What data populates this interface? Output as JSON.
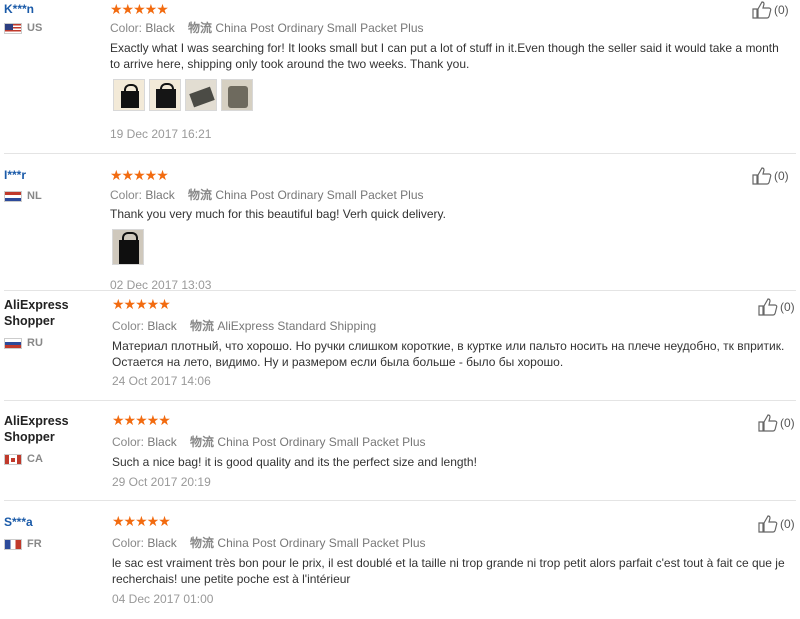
{
  "reviews": [
    {
      "user": "K***n",
      "country": "US",
      "color_label": "Color:",
      "color": "Black",
      "shipping_label": "物流",
      "shipping": "China Post Ordinary Small Packet Plus",
      "text": "Exactly what I was searching for! It looks small but I can put a lot of stuff in it.Even though the seller said it would take a month to arrive here, shipping only took around the two weeks. Thank you.",
      "date": "19 Dec 2017 16:21",
      "likes": "(0)"
    },
    {
      "user": "I***r",
      "country": "NL",
      "color_label": "Color:",
      "color": "Black",
      "shipping_label": "物流",
      "shipping": "China Post Ordinary Small Packet Plus",
      "text": "Thank you very much for this beautiful bag! Verh quick delivery.",
      "date": "02 Dec 2017 13:03",
      "likes": "(0)"
    },
    {
      "user": "AliExpress Shopper",
      "country": "RU",
      "color_label": "Color:",
      "color": "Black",
      "shipping_label": "物流",
      "shipping": "AliExpress Standard Shipping",
      "text": "Материал плотный, что хорошо. Но ручки слишком короткие, в куртке или пальто носить на плече неудобно, тк впритик. Остается на лето, видимо. Ну и размером если была больше - было бы хорошо.",
      "date": "24 Oct 2017 14:06",
      "likes": "(0)"
    },
    {
      "user": "AliExpress Shopper",
      "country": "CA",
      "color_label": "Color:",
      "color": "Black",
      "shipping_label": "物流",
      "shipping": "China Post Ordinary Small Packet Plus",
      "text": "Such a nice bag! it is good quality and its the perfect size and length!",
      "date": "29 Oct 2017 20:19",
      "likes": "(0)"
    },
    {
      "user": "S***a",
      "country": "FR",
      "color_label": "Color:",
      "color": "Black",
      "shipping_label": "物流",
      "shipping": "China Post Ordinary Small Packet Plus",
      "text": "le sac est vraiment très bon pour le prix, il est doublé et la taille ni trop grande ni trop petit alors parfait c'est tout à fait ce que je recherchais! une petite poche est à l'intérieur",
      "date": "04 Dec 2017 01:00",
      "likes": "(0)"
    }
  ],
  "stars_glyph": "★★★★★",
  "rating": 5,
  "accent_color": "#f26b10",
  "link_color": "#1a5aa8"
}
